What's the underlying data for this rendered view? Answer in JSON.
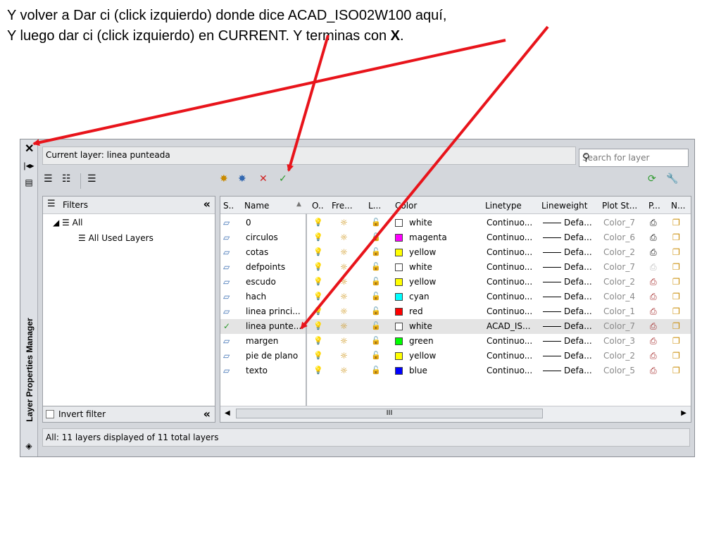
{
  "caption": {
    "line1": "Y volver a Dar ci (click izquierdo) donde dice ACAD_ISO02W100 aquí,",
    "line2_pre": "Y luego dar ci (click izquierdo) en CURRENT. Y terminas con ",
    "line2_bold": "X",
    "line2_post": "."
  },
  "palette": {
    "title": "Layer Properties Manager",
    "close_label": "✕"
  },
  "current_layer_label": "Current layer: linea punteada",
  "search_placeholder": "Search for layer",
  "filters": {
    "header": "Filters",
    "collapse": "«",
    "tree": [
      {
        "label": "All",
        "expanded": true
      },
      {
        "label": "All Used Layers"
      }
    ],
    "invert_filter": "Invert filter"
  },
  "columns": [
    "S..",
    "Name",
    "O..",
    "Fre...",
    "L...",
    "Color",
    "Linetype",
    "Lineweight",
    "Plot St...",
    "P...",
    "N..."
  ],
  "layers": [
    {
      "status": "layer",
      "name": "0",
      "color": "white",
      "color_hex": "#ffffff",
      "linetype": "Continuo...",
      "lineweight": "Defa...",
      "plot_style": "Color_7",
      "plot_printer": "printer-icon"
    },
    {
      "status": "layer",
      "name": "circulos",
      "color": "magenta",
      "color_hex": "#ff00ff",
      "linetype": "Continuo...",
      "lineweight": "Defa...",
      "plot_style": "Color_6",
      "plot_printer": "printer-icon"
    },
    {
      "status": "layer",
      "name": "cotas",
      "color": "yellow",
      "color_hex": "#ffff00",
      "linetype": "Continuo...",
      "lineweight": "Defa...",
      "plot_style": "Color_2",
      "plot_printer": "printer-icon"
    },
    {
      "status": "layer",
      "name": "defpoints",
      "color": "white",
      "color_hex": "#ffffff",
      "linetype": "Continuo...",
      "lineweight": "Defa...",
      "plot_style": "Color_7",
      "plot_printer": "printer-disabled-icon"
    },
    {
      "status": "layer",
      "name": "escudo",
      "color": "yellow",
      "color_hex": "#ffff00",
      "linetype": "Continuo...",
      "lineweight": "Defa...",
      "plot_style": "Color_2",
      "plot_printer": "no-plot-icon"
    },
    {
      "status": "layer",
      "name": "hach",
      "color": "cyan",
      "color_hex": "#00ffff",
      "linetype": "Continuo...",
      "lineweight": "Defa...",
      "plot_style": "Color_4",
      "plot_printer": "no-plot-icon"
    },
    {
      "status": "layer",
      "name": "linea princi...",
      "color": "red",
      "color_hex": "#ff0000",
      "linetype": "Continuo...",
      "lineweight": "Defa...",
      "plot_style": "Color_1",
      "plot_printer": "no-plot-icon"
    },
    {
      "status": "current",
      "name": "linea punte...",
      "color": "white",
      "color_hex": "#ffffff",
      "linetype": "ACAD_IS...",
      "lineweight": "Defa...",
      "plot_style": "Color_7",
      "plot_printer": "no-plot-icon"
    },
    {
      "status": "layer",
      "name": "margen",
      "color": "green",
      "color_hex": "#00ff00",
      "linetype": "Continuo...",
      "lineweight": "Defa...",
      "plot_style": "Color_3",
      "plot_printer": "no-plot-icon"
    },
    {
      "status": "layer",
      "name": "pie de plano",
      "color": "yellow",
      "color_hex": "#ffff00",
      "linetype": "Continuo...",
      "lineweight": "Defa...",
      "plot_style": "Color_2",
      "plot_printer": "no-plot-icon"
    },
    {
      "status": "layer",
      "name": "texto",
      "color": "blue",
      "color_hex": "#0000ff",
      "linetype": "Continuo...",
      "lineweight": "Defa...",
      "plot_style": "Color_5",
      "plot_printer": "no-plot-icon"
    }
  ],
  "scroll_thumb_label": "III",
  "status_text": "All: 11 layers displayed of 11 total layers",
  "annotation_color": "#e8141b"
}
